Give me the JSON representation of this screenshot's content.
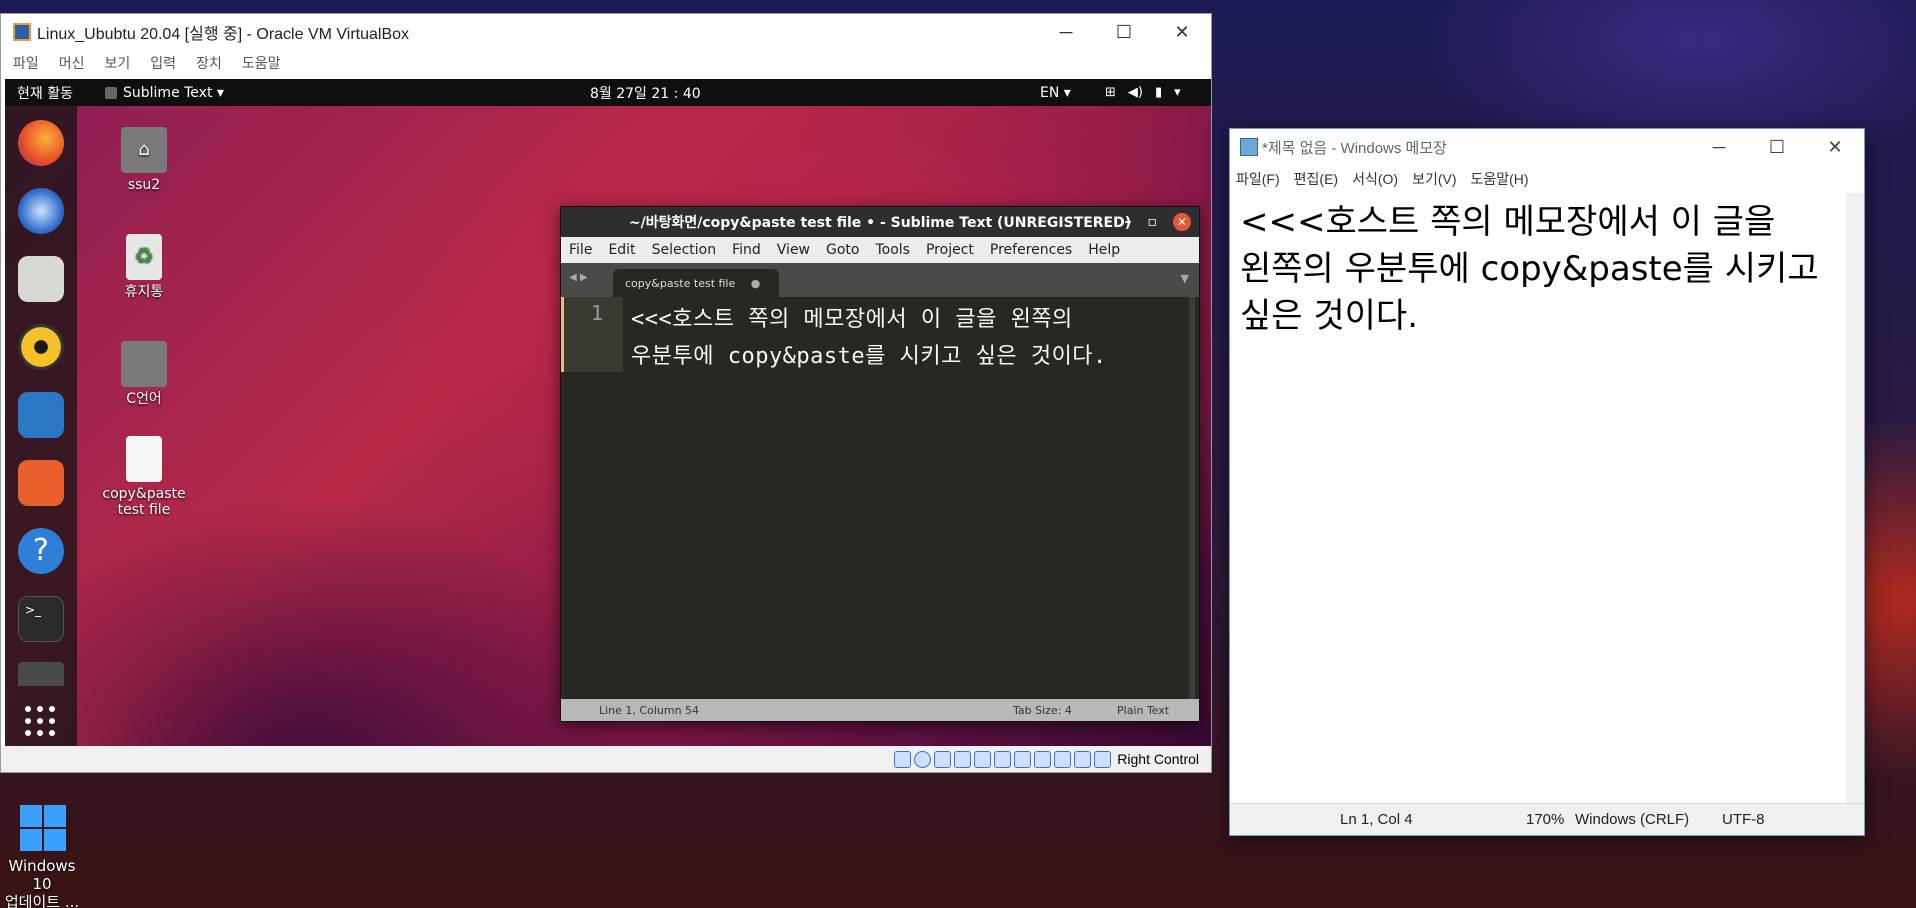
{
  "desktop_shortcut": {
    "label_line1": "Windows 10",
    "label_line2": "업데이트 ..."
  },
  "vbox": {
    "title": "Linux_Ububtu 20.04 [실행 중] - Oracle VM VirtualBox",
    "controls": [
      "─",
      "☐",
      "✕"
    ],
    "menu": [
      "파일",
      "머신",
      "보기",
      "입력",
      "장치",
      "도움말"
    ],
    "status_host_key": "Right Control"
  },
  "ubuntu": {
    "topbar": {
      "activities": "현재 활동",
      "app": "Sublime Text ▾",
      "clock": "8월 27일  21 : 40",
      "lang": "EN ▾",
      "tray": [
        "⊞",
        "◀)",
        "▮",
        "▾"
      ]
    },
    "desktop_icons": [
      {
        "label": "ssu2"
      },
      {
        "label": "휴지통"
      },
      {
        "label": "C언어"
      },
      {
        "label": "copy&paste test file"
      }
    ]
  },
  "sublime": {
    "title": "~/바탕화면/copy&paste test file • - Sublime Text (UNREGISTERED)",
    "controls": [
      "–",
      "▫",
      "✕"
    ],
    "menu": [
      "File",
      "Edit",
      "Selection",
      "Find",
      "View",
      "Goto",
      "Tools",
      "Project",
      "Preferences",
      "Help"
    ],
    "tab": "copy&paste test file",
    "tab_dot": "●",
    "line_number": "1",
    "code_line1": "<<<호스트 쪽의 메모장에서 이 글을 왼쪽의",
    "code_line2": "우분투에 copy&paste를 시키고 싶은 것이다.",
    "status_pos": "Line 1, Column 54",
    "status_tab": "Tab Size: 4",
    "status_syntax": "Plain Text"
  },
  "notepad": {
    "title": "*제목 없음 - Windows 메모장",
    "controls": [
      "─",
      "☐",
      "✕"
    ],
    "menu": [
      "파일(F)",
      "편집(E)",
      "서식(O)",
      "보기(V)",
      "도움말(H)"
    ],
    "text_line1": "<<<호스트 쪽의 메모장에서 이 글을",
    "text_line2": "왼쪽의 우분투에 copy&paste를 시키고",
    "text_line3": "싶은 것이다.",
    "status_pos": "Ln 1, Col 4",
    "status_zoom": "170%",
    "status_eol": "Windows (CRLF)",
    "status_enc": "UTF-8"
  }
}
